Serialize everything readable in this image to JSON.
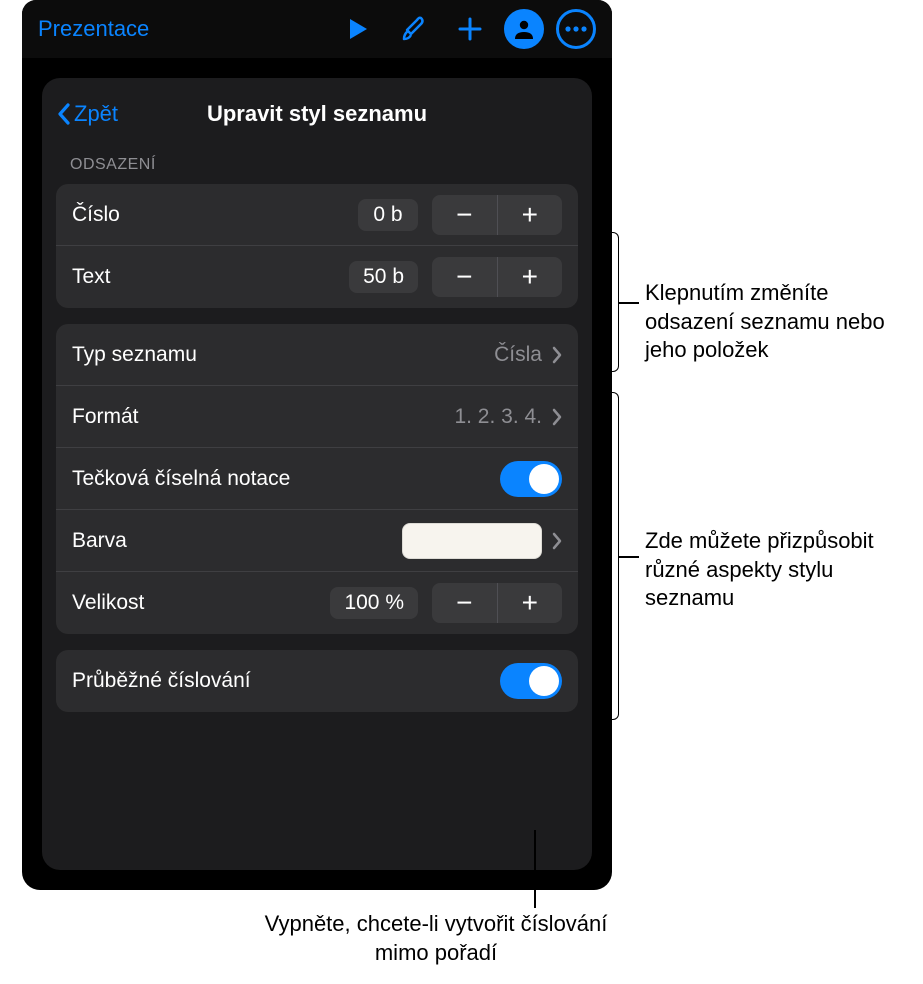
{
  "toolbar": {
    "title": "Prezentace"
  },
  "panel": {
    "back": "Zpět",
    "title": "Upravit styl seznamu",
    "indent_header": "ODSAZENÍ",
    "rows": {
      "number_label": "Číslo",
      "number_value": "0 b",
      "text_label": "Text",
      "text_value": "50 b",
      "list_type_label": "Typ seznamu",
      "list_type_value": "Čísla",
      "format_label": "Formát",
      "format_value": "1. 2. 3. 4.",
      "dot_notation_label": "Tečková číselná notace",
      "dot_notation_on": true,
      "color_label": "Barva",
      "size_label": "Velikost",
      "size_value": "100 %",
      "continuous_label": "Průběžné číslování",
      "continuous_on": true
    }
  },
  "callouts": {
    "indent": "Klepnutím změníte odsazení seznamu nebo jeho položek",
    "aspects": "Zde můžete přizpůsobit různé aspekty stylu seznamu",
    "continuous": "Vypněte, chcete-li vytvořit číslování mimo pořadí"
  }
}
